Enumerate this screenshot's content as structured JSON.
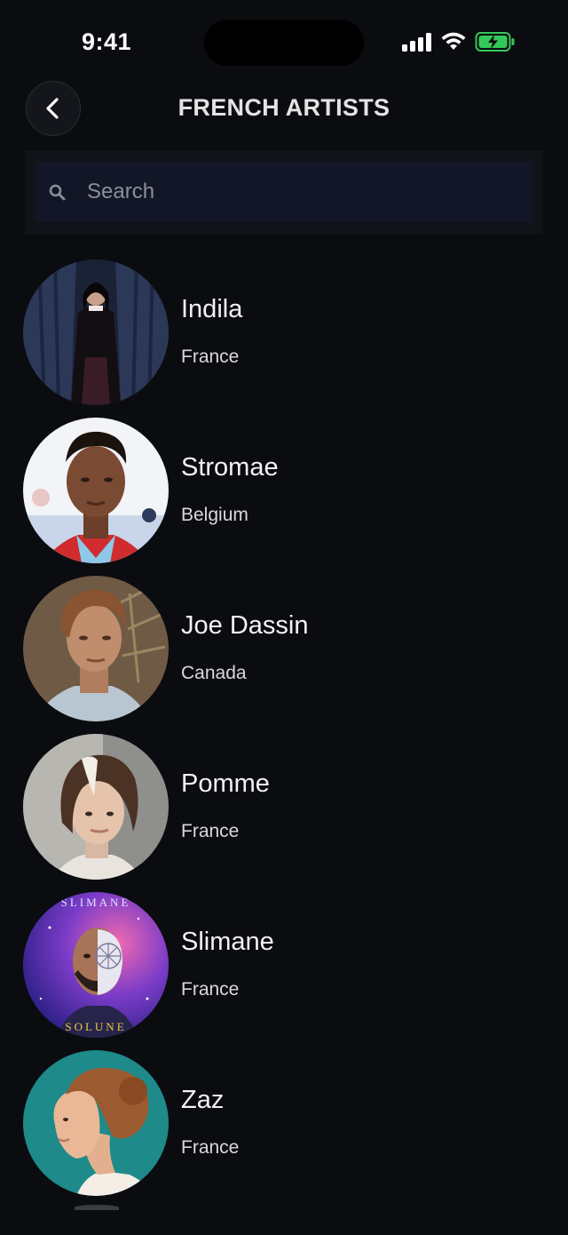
{
  "status_bar": {
    "time": "9:41",
    "icons": [
      "cellular-signal-icon",
      "wifi-icon",
      "battery-charging-icon"
    ]
  },
  "header": {
    "back_icon": "chevron-left-icon",
    "title": "FRENCH ARTISTS"
  },
  "search": {
    "icon": "search-icon",
    "placeholder": "Search",
    "value": ""
  },
  "artists": [
    {
      "name": "Indila",
      "country": "France"
    },
    {
      "name": "Stromae",
      "country": "Belgium"
    },
    {
      "name": "Joe Dassin",
      "country": "Canada"
    },
    {
      "name": "Pomme",
      "country": "France"
    },
    {
      "name": "Slimane",
      "country": "France"
    },
    {
      "name": "Zaz",
      "country": "France"
    }
  ],
  "album_art_text": {
    "top": "SLIMANE",
    "bottom": "SOLUNE"
  },
  "colors": {
    "background": "#0a0c10",
    "search_field": "#121626",
    "battery_charging": "#34c759"
  }
}
